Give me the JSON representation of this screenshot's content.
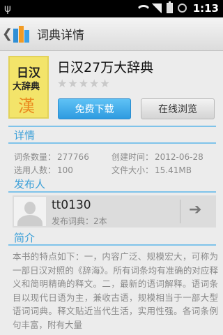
{
  "status_bar": {
    "usb_symbol": "ψ",
    "time": "1:13",
    "icons": [
      "wifi-icon",
      "signal-icon",
      "battery-icon",
      "alarm-icon"
    ]
  },
  "title_bar": {
    "back_symbol": "❮",
    "title": "词典详情"
  },
  "book": {
    "title": "日汉27万大辞典",
    "cover_line1": "日汉",
    "cover_line2": "大辞典",
    "cover_glyph": "漢",
    "rating": 0,
    "rating_max": 5
  },
  "buttons": {
    "free_download": "免费下载",
    "browse_online": "在线浏览"
  },
  "sections": {
    "details": "详情",
    "publisher": "发布人",
    "intro": "简介"
  },
  "details": {
    "entry_count_label": "词条数量：",
    "entry_count": "277766",
    "created_label": "创建时间：",
    "created": "2012-06-28",
    "users_label": "选用人数：",
    "users": "100",
    "size_label": "文件大小：",
    "size": "15.41MB"
  },
  "publisher": {
    "name": "tt0130",
    "published_label": "发布词典：",
    "published_count": "2本"
  },
  "intro_text": "本书的特点如下：一，内容广泛、规模宏大，可称为一部日汉对照的《辞海》。所有词条均有准确的对应释义和简明精确的释文。二，最新的语词解释。语词条目以现代日语为主，兼收古语，规模相当于一部大型语词词典。释文贴近当代生活，实用性强。各词条例句丰富，附有大量"
}
